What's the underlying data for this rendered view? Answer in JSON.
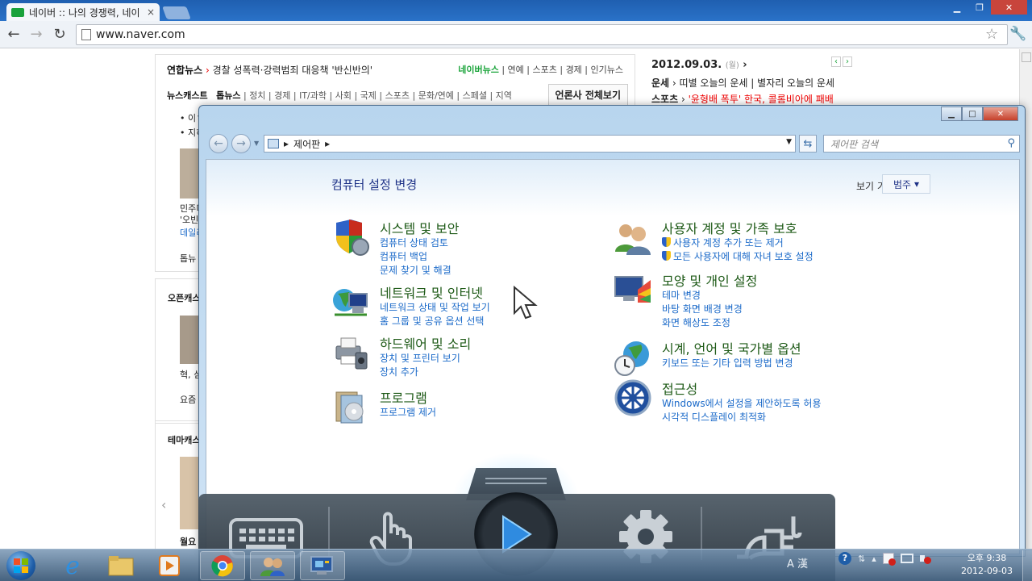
{
  "browser": {
    "tab_title": "네이버 :: 나의 경쟁력, 네이",
    "tab_close": "×",
    "url": "www.naver.com"
  },
  "naver": {
    "ticker_source": "연합뉴스",
    "ticker_text": "경찰 성폭력·강력범죄 대응책 '반신반의'",
    "ticker_links": [
      "네이버뉴스",
      "연예",
      "스포츠",
      "경제",
      "인기뉴스"
    ],
    "newscast_label": "뉴스캐스트",
    "topnews_label": "톱뉴스",
    "newscast_tabs": [
      "정치",
      "경제",
      "IT/과학",
      "사회",
      "국제",
      "스포츠",
      "문화/연예",
      "스페셜",
      "지역"
    ],
    "press_all": "언론사 전체보기",
    "left_fragments": [
      "• 이ㄱ",
      "• 지히",
      "민주디",
      "'오빈",
      "데일리",
      "톱뉴",
      "혁, 심",
      "요즘",
      "월요"
    ],
    "section_titles": [
      "오픈캐스",
      "테마캐스"
    ],
    "date": "2012.09.03.",
    "date_day": "(월)",
    "right_lines": [
      {
        "label": "운세",
        "text": "띠별 오늘의 운세  |  별자리 오늘의 운세"
      },
      {
        "label": "스포츠",
        "text": "'윤형배 폭투' 한국, 콜롬비아에 패배"
      }
    ]
  },
  "control_panel": {
    "breadcrumb": "제어판",
    "search_placeholder": "제어판 검색",
    "page_title": "컴퓨터 설정 변경",
    "view_by_label": "보기 기준:",
    "view_by_value": "범주",
    "categories_left": [
      {
        "icon": "security-shield-icon",
        "title": "시스템 및 보안",
        "links": [
          "컴퓨터 상태 검토",
          "컴퓨터 백업",
          "문제 찾기 및 해결"
        ]
      },
      {
        "icon": "network-globe-icon",
        "title": "네트워크 및 인터넷",
        "links": [
          "네트워크 상태 및 작업 보기",
          "홈 그룹 및 공유 옵션 선택"
        ]
      },
      {
        "icon": "printer-icon",
        "title": "하드웨어 및 소리",
        "links": [
          "장치 및 프린터 보기",
          "장치 추가"
        ]
      },
      {
        "icon": "programs-icon",
        "title": "프로그램",
        "links": [
          "프로그램 제거"
        ]
      }
    ],
    "categories_right": [
      {
        "icon": "users-icon",
        "title": "사용자 계정 및 가족 보호",
        "links": [
          "사용자 계정 추가 또는 제거",
          "모든 사용자에 대해 자녀 보호 설정"
        ]
      },
      {
        "icon": "appearance-icon",
        "title": "모양 및 개인 설정",
        "links": [
          "테마 변경",
          "바탕 화면 배경 변경",
          "화면 해상도 조정"
        ]
      },
      {
        "icon": "clock-globe-icon",
        "title": "시계, 언어 및 국가별 옵션",
        "links": [
          "키보드 또는 기타 입력 방법 변경"
        ]
      },
      {
        "icon": "accessibility-icon",
        "title": "접근성",
        "links": [
          "Windows에서 설정을 제안하도록 허용",
          "시각적 디스플레이 최적화"
        ]
      }
    ]
  },
  "taskbar": {
    "ime_text": "A 漢",
    "time": "오후 9:38",
    "date": "2012-09-03"
  },
  "colors": {
    "link_blue": "#1b6ac9",
    "category_green": "#1e5a17",
    "title_blue": "#1e3287",
    "naver_green": "#1aa43a"
  }
}
